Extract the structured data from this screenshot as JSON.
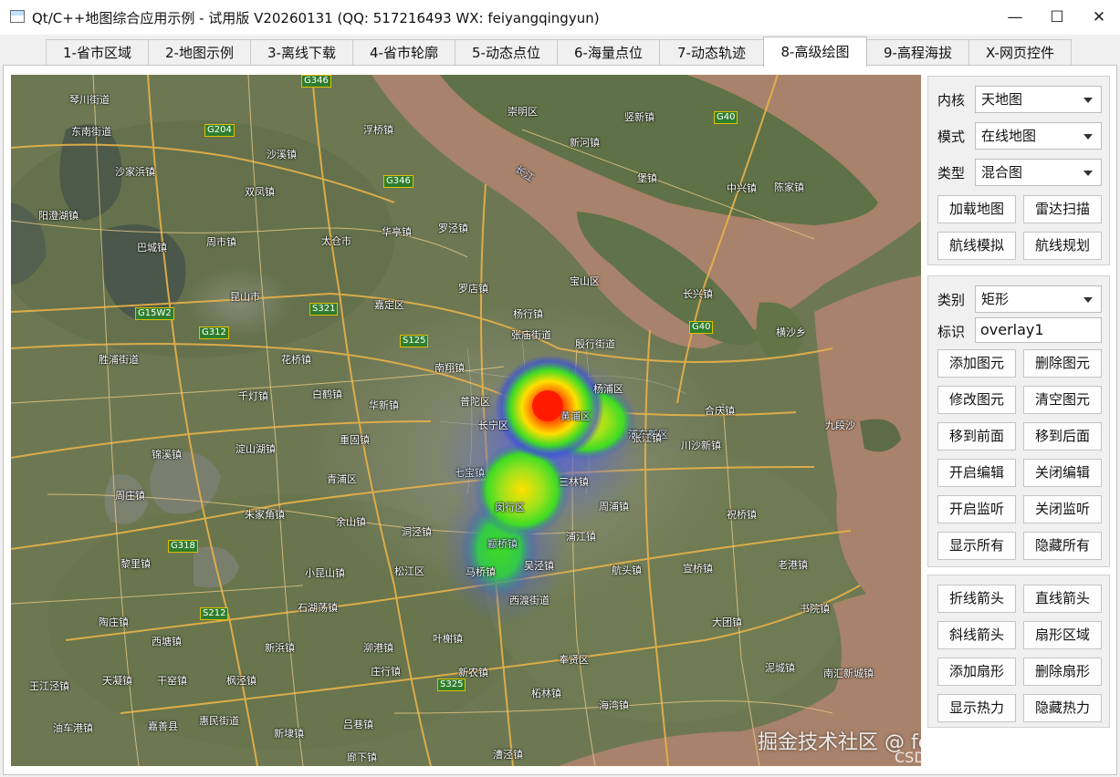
{
  "window": {
    "title": "Qt/C++地图综合应用示例 - 试用版 V20260131 (QQ: 517216493 WX: feiyangqingyun)",
    "minimize_glyph": "—",
    "maximize_glyph": "☐",
    "close_glyph": "✕"
  },
  "tabs": [
    {
      "label": "1-省市区域"
    },
    {
      "label": "2-地图示例"
    },
    {
      "label": "3-离线下载"
    },
    {
      "label": "4-省市轮廓"
    },
    {
      "label": "5-动态点位"
    },
    {
      "label": "6-海量点位"
    },
    {
      "label": "7-动态轨迹"
    },
    {
      "label": "8-高级绘图",
      "active": true
    },
    {
      "label": "9-高程海拔"
    },
    {
      "label": "X-网页控件"
    }
  ],
  "map_panel": {
    "kernel_label": "内核",
    "kernel_value": "天地图",
    "mode_label": "模式",
    "mode_value": "在线地图",
    "type_label": "类型",
    "type_value": "混合图",
    "buttons": [
      "加载地图",
      "雷达扫描",
      "航线模拟",
      "航线规划"
    ]
  },
  "overlay_panel": {
    "category_label": "类别",
    "category_value": "矩形",
    "id_label": "标识",
    "id_value": "overlay1",
    "buttons": [
      "添加图元",
      "删除图元",
      "修改图元",
      "清空图元",
      "移到前面",
      "移到后面",
      "开启编辑",
      "关闭编辑",
      "开启监听",
      "关闭监听",
      "显示所有",
      "隐藏所有"
    ]
  },
  "shape_panel": {
    "buttons": [
      "折线箭头",
      "直线箭头",
      "斜线箭头",
      "扇形区域",
      "添加扇形",
      "删除扇形",
      "显示热力",
      "隐藏热力"
    ]
  },
  "map": {
    "labels": [
      "琴川街道",
      "东南街道",
      "浮桥镇",
      "沙溪镇",
      "沙家浜镇",
      "双凤镇",
      "阳澄湖镇",
      "巴城镇",
      "周市镇",
      "太仓市",
      "华亭镇",
      "罗泾镇",
      "宝山区",
      "崇明区",
      "竖新镇",
      "新河镇",
      "堡镇",
      "中兴镇",
      "陈家镇",
      "长兴镇",
      "横沙乡",
      "九段沙",
      "昆山市",
      "嘉定区",
      "罗店镇",
      "杨行镇",
      "张庙街道",
      "殷行街道",
      "花桥镇",
      "胜浦街道",
      "南翔镇",
      "普陀区",
      "杨浦区",
      "长宁区",
      "黄浦区",
      "浦东新区",
      "合庆镇",
      "张江镇",
      "川沙新镇",
      "千灯镇",
      "白鹤镇",
      "华新镇",
      "重固镇",
      "青浦区",
      "锦溪镇",
      "淀山湖镇",
      "周庄镇",
      "朱家角镇",
      "余山镇",
      "七宝镇",
      "闵行区",
      "三林镇",
      "周浦镇",
      "祝桥镇",
      "洞泾镇",
      "颛桥镇",
      "浦江镇",
      "黎里镇",
      "小昆山镇",
      "松江区",
      "马桥镇",
      "吴泾镇",
      "航头镇",
      "宣桥镇",
      "老港镇",
      "石湖荡镇",
      "西渡街道",
      "书院镇",
      "陶庄镇",
      "新浜镇",
      "泖港镇",
      "叶榭镇",
      "大团镇",
      "西塘镇",
      "新农镇",
      "庄行镇",
      "奉贤区",
      "泥城镇",
      "天凝镇",
      "干窑镇",
      "枫泾镇",
      "南汇新城镇",
      "王江泾镇",
      "惠民街道",
      "新埭镇",
      "吕巷镇",
      "柘林镇",
      "海湾镇",
      "油车港镇",
      "嘉善县",
      "廊下镇",
      "漕泾镇",
      "长江"
    ],
    "shields": [
      "G346",
      "G204",
      "G346",
      "G40",
      "G15W2",
      "G312",
      "S321",
      "S125",
      "G40",
      "G318",
      "S212",
      "S325"
    ],
    "watermark": "掘金技术社区 @ feiyangqingyun",
    "csdn_watermark": "CSDN @feiyangqingyun"
  },
  "colors": {
    "heat_core": "#ff1a00",
    "heat_mid": "#ffe000",
    "heat_low": "#3ddc24",
    "heat_edge": "#3c50d8",
    "river": "#a8826a",
    "land": "#6f7a55",
    "road": "#e8b24a"
  }
}
